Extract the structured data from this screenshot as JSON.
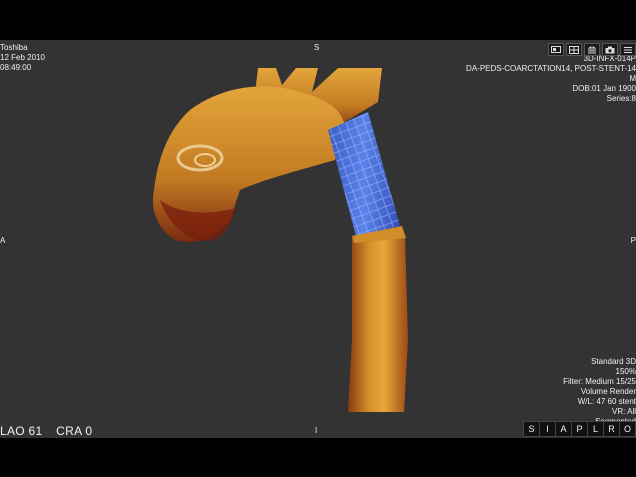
{
  "header": {
    "manufacturer": "Toshiba",
    "study_date": "12 Feb 2010",
    "study_time": "08:49:00"
  },
  "patient": {
    "id": "3D-INFX-014P",
    "study": "DA-PEDS-COARCTATION14, POST-STENT-14",
    "sex": "M",
    "dob": "DOB:01 Jan 1900",
    "series": "Series:8"
  },
  "orientation": {
    "top": "S",
    "left": "A",
    "right": "P",
    "bottom": "I"
  },
  "render_info": {
    "preset": "Standard 3D",
    "zoom": "150%",
    "filter": "Filter: Medium 15/25",
    "mode": "Volume Render",
    "window_level": "W/L: 47 60 stent",
    "vr": "VR: All",
    "segmentation": "Segmented"
  },
  "projection": {
    "lao": "LAO 61",
    "cra": "CRA 0"
  },
  "toolbar_icons": [
    "monitor-icon",
    "layout-icon",
    "hands-icon",
    "camera-icon",
    "menu-icon"
  ],
  "orientation_buttons": [
    "S",
    "I",
    "A",
    "P",
    "L",
    "R",
    "O"
  ],
  "colors": {
    "vessel": "#c8852a",
    "stent": "#4a6fd8",
    "background": "#333333"
  }
}
